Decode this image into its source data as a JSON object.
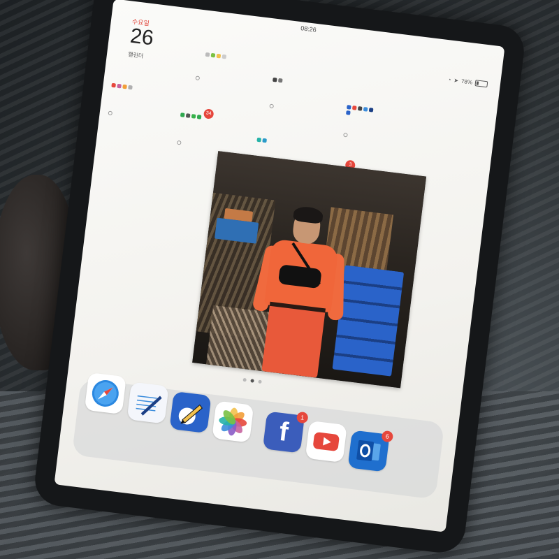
{
  "status_bar": {
    "time": "08:26",
    "battery_percent": "78%"
  },
  "date_widget": {
    "weekday": "수요일",
    "day": "26",
    "subtitle": "캘린더"
  },
  "folder_badges": {
    "left_folder": "34",
    "right_folder": "3"
  },
  "dock": {
    "apps": [
      {
        "name": "safari-icon"
      },
      {
        "name": "notes-pen-icon"
      },
      {
        "name": "sketch-pencil-icon"
      },
      {
        "name": "photos-icon"
      },
      {
        "name": "facebook-icon",
        "badge": "1"
      },
      {
        "name": "youtube-icon"
      },
      {
        "name": "outlook-icon",
        "badge": "6"
      }
    ]
  },
  "page_indicator": {
    "pages": 3,
    "current": 2
  },
  "colors": {
    "badge": "#e6473c",
    "screen_bg": "#f7f7f4",
    "shirt": "#f0663a",
    "crates": "#2a63c9"
  }
}
